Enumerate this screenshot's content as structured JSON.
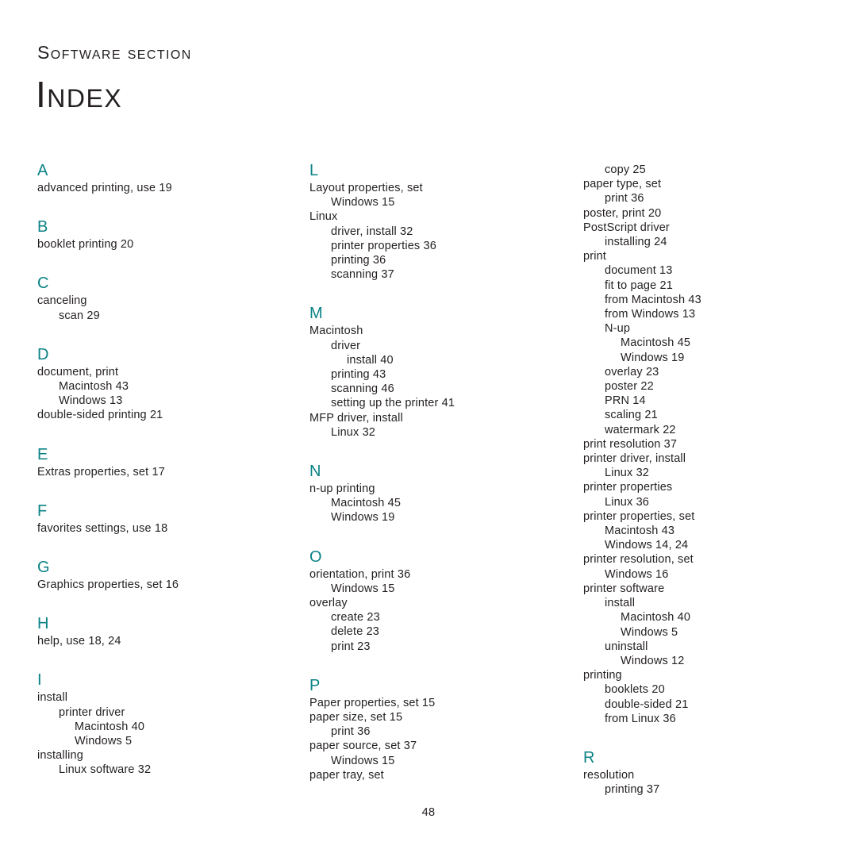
{
  "header": {
    "kicker": "Software section",
    "title": "Index"
  },
  "folio": "48",
  "accent_color": "#0b8285",
  "text_color": "#231f20",
  "columns": [
    {
      "name": "column-1",
      "groups": [
        {
          "letter": "A",
          "continued": false,
          "entries": [
            {
              "text": "advanced printing, use 19",
              "level": 0
            }
          ]
        },
        {
          "letter": "B",
          "continued": false,
          "entries": [
            {
              "text": "booklet printing 20",
              "level": 0
            }
          ]
        },
        {
          "letter": "C",
          "continued": false,
          "entries": [
            {
              "text": "canceling",
              "level": 0
            },
            {
              "text": "scan 29",
              "level": 1
            }
          ]
        },
        {
          "letter": "D",
          "continued": false,
          "entries": [
            {
              "text": "document, print",
              "level": 0
            },
            {
              "text": "Macintosh 43",
              "level": 1
            },
            {
              "text": "Windows 13",
              "level": 1
            },
            {
              "text": "double-sided printing 21",
              "level": 0
            }
          ]
        },
        {
          "letter": "E",
          "continued": false,
          "entries": [
            {
              "text": "Extras properties, set 17",
              "level": 0
            }
          ]
        },
        {
          "letter": "F",
          "continued": false,
          "entries": [
            {
              "text": "favorites settings, use 18",
              "level": 0
            }
          ]
        },
        {
          "letter": "G",
          "continued": false,
          "entries": [
            {
              "text": "Graphics properties, set 16",
              "level": 0
            }
          ]
        },
        {
          "letter": "H",
          "continued": false,
          "entries": [
            {
              "text": "help, use 18, 24",
              "level": 0
            }
          ]
        },
        {
          "letter": "I",
          "continued": false,
          "entries": [
            {
              "text": "install",
              "level": 0
            },
            {
              "text": "printer driver",
              "level": 1
            },
            {
              "text": "Macintosh 40",
              "level": 2
            },
            {
              "text": "Windows 5",
              "level": 2
            },
            {
              "text": "installing",
              "level": 0
            },
            {
              "text": "Linux software 32",
              "level": 1
            }
          ]
        }
      ]
    },
    {
      "name": "column-2",
      "groups": [
        {
          "letter": "L",
          "continued": false,
          "entries": [
            {
              "text": "Layout properties, set",
              "level": 0
            },
            {
              "text": "Windows 15",
              "level": 1
            },
            {
              "text": "Linux",
              "level": 0
            },
            {
              "text": "driver, install 32",
              "level": 1
            },
            {
              "text": "printer properties 36",
              "level": 1
            },
            {
              "text": "printing 36",
              "level": 1
            },
            {
              "text": "scanning 37",
              "level": 1
            }
          ]
        },
        {
          "letter": "M",
          "continued": false,
          "entries": [
            {
              "text": "Macintosh",
              "level": 0
            },
            {
              "text": "driver",
              "level": 1
            },
            {
              "text": "install 40",
              "level": 2
            },
            {
              "text": "printing 43",
              "level": 1
            },
            {
              "text": "scanning 46",
              "level": 1
            },
            {
              "text": "setting up the printer 41",
              "level": 1
            },
            {
              "text": "MFP driver, install",
              "level": 0
            },
            {
              "text": "Linux 32",
              "level": 1
            }
          ]
        },
        {
          "letter": "N",
          "continued": false,
          "entries": [
            {
              "text": "n-up printing",
              "level": 0
            },
            {
              "text": "Macintosh 45",
              "level": 1
            },
            {
              "text": "Windows 19",
              "level": 1
            }
          ]
        },
        {
          "letter": "O",
          "continued": false,
          "entries": [
            {
              "text": "orientation, print 36",
              "level": 0
            },
            {
              "text": "Windows 15",
              "level": 1
            },
            {
              "text": "overlay",
              "level": 0
            },
            {
              "text": "create 23",
              "level": 1
            },
            {
              "text": "delete 23",
              "level": 1
            },
            {
              "text": "print 23",
              "level": 1
            }
          ]
        },
        {
          "letter": "P",
          "continued": false,
          "entries": [
            {
              "text": "Paper properties, set 15",
              "level": 0
            },
            {
              "text": "paper size, set 15",
              "level": 0
            },
            {
              "text": "print 36",
              "level": 1
            },
            {
              "text": "paper source, set 37",
              "level": 0
            },
            {
              "text": "Windows 15",
              "level": 1
            },
            {
              "text": "paper tray, set",
              "level": 0
            }
          ]
        }
      ]
    },
    {
      "name": "column-3",
      "groups": [
        {
          "letter": "P",
          "continued": true,
          "entries": [
            {
              "text": "copy 25",
              "level": 1
            },
            {
              "text": "paper type, set",
              "level": 0
            },
            {
              "text": "print 36",
              "level": 1
            },
            {
              "text": "poster, print 20",
              "level": 0
            },
            {
              "text": "PostScript driver",
              "level": 0
            },
            {
              "text": "installing 24",
              "level": 1
            },
            {
              "text": "print",
              "level": 0
            },
            {
              "text": "document 13",
              "level": 1
            },
            {
              "text": "fit to page 21",
              "level": 1
            },
            {
              "text": "from Macintosh 43",
              "level": 1
            },
            {
              "text": "from Windows 13",
              "level": 1
            },
            {
              "text": "N-up",
              "level": 1
            },
            {
              "text": "Macintosh 45",
              "level": 2
            },
            {
              "text": "Windows 19",
              "level": 2
            },
            {
              "text": "overlay 23",
              "level": 1
            },
            {
              "text": "poster 22",
              "level": 1
            },
            {
              "text": "PRN 14",
              "level": 1
            },
            {
              "text": "scaling 21",
              "level": 1
            },
            {
              "text": "watermark 22",
              "level": 1
            },
            {
              "text": "print resolution 37",
              "level": 0
            },
            {
              "text": "printer driver, install",
              "level": 0
            },
            {
              "text": "Linux 32",
              "level": 1
            },
            {
              "text": "printer properties",
              "level": 0
            },
            {
              "text": "Linux 36",
              "level": 1
            },
            {
              "text": "printer properties, set",
              "level": 0
            },
            {
              "text": "Macintosh 43",
              "level": 1
            },
            {
              "text": "Windows 14, 24",
              "level": 1
            },
            {
              "text": "printer resolution, set",
              "level": 0
            },
            {
              "text": "Windows 16",
              "level": 1
            },
            {
              "text": "printer software",
              "level": 0
            },
            {
              "text": "install",
              "level": 1
            },
            {
              "text": "Macintosh 40",
              "level": 2
            },
            {
              "text": "Windows 5",
              "level": 2
            },
            {
              "text": "uninstall",
              "level": 1
            },
            {
              "text": "Windows 12",
              "level": 2
            },
            {
              "text": "printing",
              "level": 0
            },
            {
              "text": "booklets 20",
              "level": 1
            },
            {
              "text": "double-sided 21",
              "level": 1
            },
            {
              "text": "from Linux 36",
              "level": 1
            }
          ]
        },
        {
          "letter": "R",
          "continued": false,
          "entries": [
            {
              "text": "resolution",
              "level": 0
            },
            {
              "text": "printing 37",
              "level": 1
            }
          ]
        }
      ]
    }
  ]
}
